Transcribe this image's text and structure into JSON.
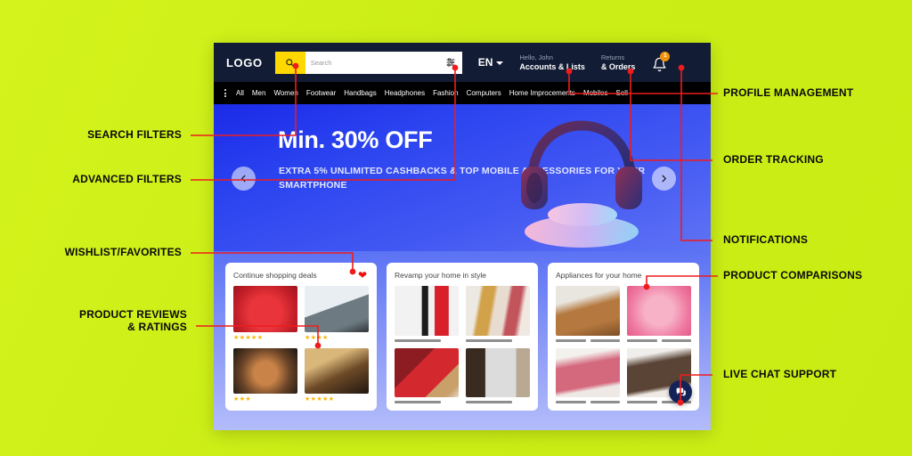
{
  "theme": {
    "page_background": "#cbee16",
    "header_bg": "#121c35",
    "nav_bg": "#000000",
    "accent_yellow": "#ffd800",
    "hero_blue": "#2b44f0",
    "badge_orange": "#f0920a",
    "annotation_red": "#ee1c1c",
    "star_gold": "#ffb400",
    "heart_red": "#ee1111",
    "chat_navy": "#132358"
  },
  "header": {
    "logo": "LOGO",
    "search": {
      "placeholder": "Search",
      "value": "",
      "search_icon": "search-icon",
      "filter_icon": "sliders-filter-icon"
    },
    "language": {
      "label": "EN",
      "chevron_icon": "chevron-down-icon"
    },
    "account": {
      "line1": "Hello, John",
      "line2": "Accounts & Lists"
    },
    "orders": {
      "line1": "Returns",
      "line2": "& Orders"
    },
    "notifications": {
      "icon": "bell-icon",
      "badge_count": "1"
    }
  },
  "nav": {
    "menu_icon": "kebab-menu-icon",
    "items": [
      "All",
      "Men",
      "Women",
      "Footwear",
      "Handbags",
      "Headphones",
      "Fashion",
      "Computers",
      "Home Improcements",
      "Mobiles",
      "Sell"
    ]
  },
  "hero": {
    "title": "Min. 30% OFF",
    "subtitle": "EXTRA 5% UNLIMITED\nCASHBACKS & TOP MOBILE\nACCESSORIES FOR YOUR SMARTPHONE",
    "prev_icon": "chevron-left-icon",
    "next_icon": "chevron-right-icon",
    "product_image": "headphones-on-podium"
  },
  "cards": [
    {
      "title": "Continue shopping deals",
      "has_heart": true,
      "heart_icon": "heart-filled-icon",
      "rating_style": "stars",
      "tiles": [
        {
          "image": "red-air-fryer",
          "stars": 5
        },
        {
          "image": "electric-kettle",
          "stars": 4
        },
        {
          "image": "copper-coffee-maker",
          "stars": 3
        },
        {
          "image": "record-player",
          "stars": 5
        }
      ]
    },
    {
      "title": "Revamp your home in style",
      "has_heart": false,
      "rating_style": "single-bar",
      "tiles": [
        {
          "image": "black-and-red-heels",
          "bars": 1
        },
        {
          "image": "jewelry-and-cosmetics",
          "bars": 1
        },
        {
          "image": "red-handbag",
          "bars": 1
        },
        {
          "image": "modern-cabinet",
          "bars": 1
        }
      ]
    },
    {
      "title": "Appliances for your home",
      "has_heart": false,
      "rating_style": "double-bar",
      "tiles": [
        {
          "image": "tan-leather-heels",
          "bars": 2
        },
        {
          "image": "pink-sandals",
          "bars": 2
        },
        {
          "image": "pink-sneakers",
          "bars": 2
        },
        {
          "image": "brown-sneakers",
          "bars": 2
        }
      ]
    }
  ],
  "chat": {
    "icon": "chat-bubble-icon"
  },
  "annotations": {
    "left": [
      {
        "label": "SEARCH FILTERS",
        "target": "search-input"
      },
      {
        "label": "ADVANCED FILTERS",
        "target": "filter-button"
      },
      {
        "label": "WISHLIST/FAVORITES",
        "target": "heart-button"
      },
      {
        "label": "PRODUCT REVIEWS\n& RATINGS",
        "target": "star-rating"
      }
    ],
    "right": [
      {
        "label": "PROFILE MANAGEMENT",
        "target": "account-menu"
      },
      {
        "label": "ORDER TRACKING",
        "target": "returns-orders"
      },
      {
        "label": "NOTIFICATIONS",
        "target": "notification-bell"
      },
      {
        "label": "PRODUCT COMPARISONS",
        "target": "appliances-card"
      },
      {
        "label": "LIVE CHAT SUPPORT",
        "target": "chat-fab"
      }
    ]
  }
}
